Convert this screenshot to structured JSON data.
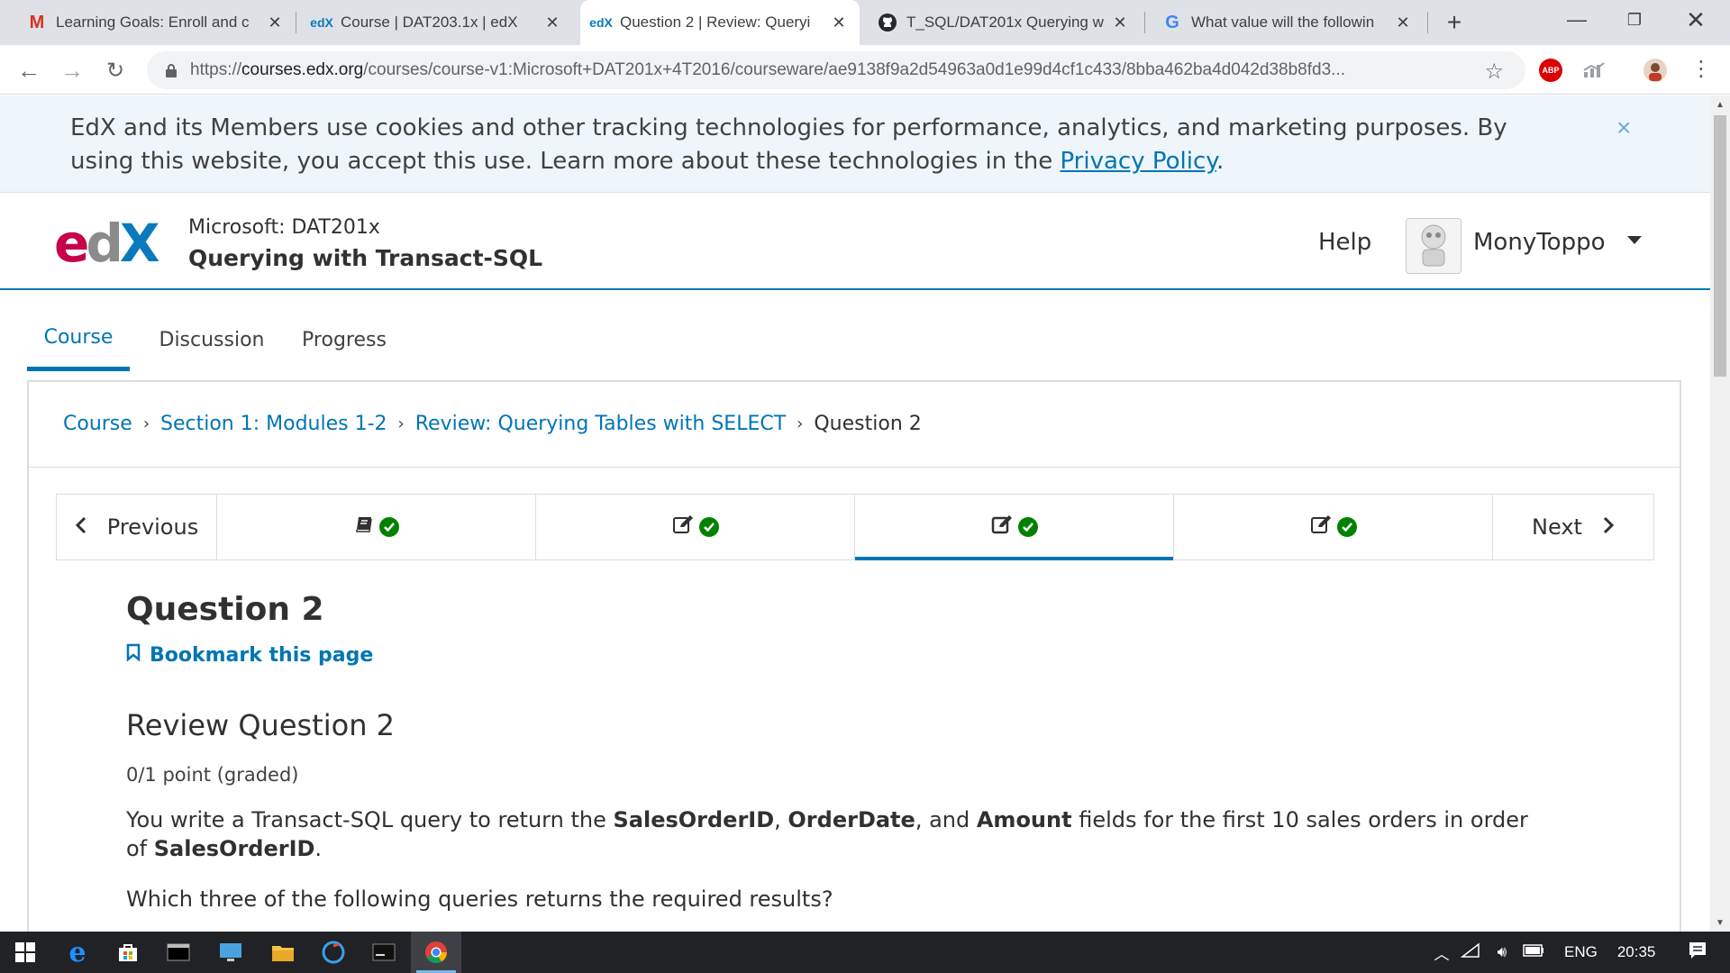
{
  "browser": {
    "tabs": [
      {
        "title": "Learning Goals: Enroll and c",
        "favicon": "gmail-icon",
        "favicon_text": "M",
        "favicon_color": "#d93025"
      },
      {
        "title": "Course | DAT203.1x | edX",
        "favicon": "edx-icon",
        "favicon_text": "edX",
        "favicon_color": "#0b79bd"
      },
      {
        "title": "Question 2 | Review: Queryi",
        "favicon": "edx-icon",
        "favicon_text": "edX",
        "favicon_color": "#0b79bd",
        "active": true
      },
      {
        "title": "T_SQL/DAT201x Querying w",
        "favicon": "github-icon",
        "favicon_text": "",
        "favicon_color": "#24292e"
      },
      {
        "title": "What value will the followin",
        "favicon": "google-icon",
        "favicon_text": "G",
        "favicon_color": "#4285f4"
      }
    ],
    "new_tab_label": "+",
    "url_prefix": "https://",
    "url_host": "courses.edx.org",
    "url_path": "/courses/course-v1:Microsoft+DAT201x+4T2016/courseware/ae9138f9a2d54963a0d1e99d4cf1c433/8bba462ba4d042d38b8fd3...",
    "extensions": [
      "adblock-plus-icon",
      "analytics-icon",
      "profile-avatar-icon"
    ],
    "abp_label": "ABP"
  },
  "cookie_banner": {
    "text": "EdX and its Members use cookies and other tracking technologies for performance, analytics, and marketing purposes. By using this website, you accept this use. Learn more about these technologies in the ",
    "link_text": "Privacy Policy",
    "suffix": ".",
    "close_label": "×"
  },
  "header": {
    "logo_e": "e",
    "logo_d": "d",
    "logo_x": "X",
    "course_org": "Microsoft: DAT201x",
    "course_name": "Querying with Transact-SQL",
    "help_label": "Help",
    "username": "MonyToppo"
  },
  "course_tabs": [
    {
      "label": "Course",
      "active": true
    },
    {
      "label": "Discussion",
      "active": false
    },
    {
      "label": "Progress",
      "active": false
    }
  ],
  "breadcrumb": {
    "items": [
      "Course",
      "Section 1: Modules 1-2",
      "Review: Querying Tables with SELECT"
    ],
    "separator": "›",
    "current": "Question 2"
  },
  "sequence_nav": {
    "previous_label": "Previous",
    "next_label": "Next",
    "units": [
      {
        "icon": "book-icon",
        "complete": true,
        "active": false
      },
      {
        "icon": "edit-icon",
        "complete": true,
        "active": false
      },
      {
        "icon": "edit-icon",
        "complete": true,
        "active": true
      },
      {
        "icon": "edit-icon",
        "complete": true,
        "active": false
      }
    ]
  },
  "content": {
    "page_title": "Question 2",
    "bookmark_label": "Bookmark this page",
    "problem_title": "Review Question 2",
    "points": "0/1 point (graded)",
    "prompt_parts": {
      "p1": "You write a Transact-SQL query to return the ",
      "f1": "SalesOrderID",
      "p2": ", ",
      "f2": "OrderDate",
      "p3": ", and ",
      "f3": "Amount",
      "p4": " fields for the first 10 sales orders in order of ",
      "f4": "SalesOrderID",
      "p5": "."
    },
    "question": "Which three of the following queries returns the required results?"
  },
  "taskbar": {
    "apps": [
      "windows-start-icon",
      "edge-icon",
      "store-icon",
      "cmd-icon",
      "remote-desktop-icon",
      "file-explorer-icon",
      "ccleaner-icon",
      "terminal-icon",
      "chrome-icon"
    ],
    "language": "ENG",
    "time": "20:35"
  },
  "colors": {
    "edx_blue": "#0075b4",
    "edx_magenta": "#c6024a",
    "success_green": "#008100",
    "cookie_bg": "#eef6fb"
  }
}
